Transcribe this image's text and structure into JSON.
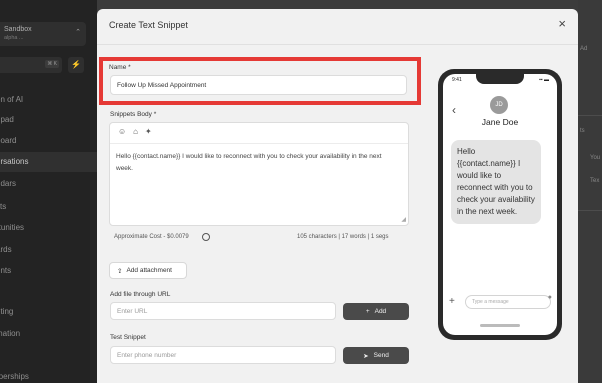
{
  "sidebar": {
    "account_name": "Sandbox",
    "account_sub": "alpha ...",
    "search_shortcut": "⌘ K",
    "items": [
      {
        "label": "on of AI"
      },
      {
        "label": "hpad"
      },
      {
        "label": "board"
      },
      {
        "label": "ersations",
        "active": true
      },
      {
        "label": "ndars"
      },
      {
        "label": "cts"
      },
      {
        "label": "rtunities"
      },
      {
        "label": "ards"
      },
      {
        "label": "ents"
      },
      {
        "label": "eting"
      },
      {
        "label": "mation"
      },
      {
        "label": "rperships"
      }
    ]
  },
  "background_right": {
    "top_label": "Ad",
    "items": [
      "ts",
      "You",
      "Tex"
    ]
  },
  "modal": {
    "title": "Create Text Snippet",
    "close": "×",
    "name_label": "Name *",
    "name_value": "Follow Up Missed Appointment",
    "body_label": "Snippets Body *",
    "body_text": "Hello {{contact.name}} I would like to reconnect with you to check your availability in the next week.",
    "cost_text": "Approximate Cost - $0.0079",
    "count_text": "105 characters | 17 words | 1 segs",
    "attach_label": "Add attachment",
    "url_label": "Add file through URL",
    "url_placeholder": "Enter URL",
    "add_label": "Add",
    "test_label": "Test Snippet",
    "phone_placeholder": "Enter phone number",
    "send_label": "Send"
  },
  "phone_preview": {
    "clock": "9:41",
    "avatar_initials": "JD",
    "contact_name": "Jane Doe",
    "message": "Hello {{contact.name}} I would like to reconnect with you to check your availability in the next week.",
    "message_placeholder": "Type a message"
  },
  "colors": {
    "highlight": "#e53935",
    "button_dark": "#4a4a4a"
  }
}
